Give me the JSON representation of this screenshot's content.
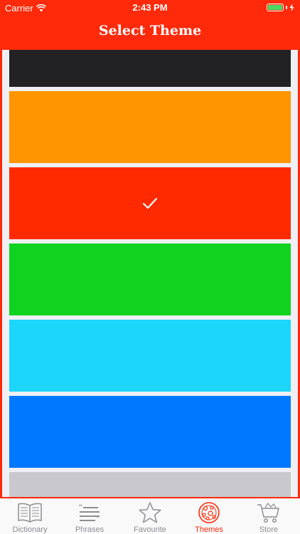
{
  "status_bar": {
    "carrier": "Carrier",
    "time": "2:43 PM"
  },
  "nav": {
    "title": "Select Theme"
  },
  "themes": [
    {
      "color": "#222225",
      "selected": false
    },
    {
      "color": "#ff9500",
      "selected": false
    },
    {
      "color": "#ff2a00",
      "selected": true
    },
    {
      "color": "#0fd31e",
      "selected": false
    },
    {
      "color": "#1cd6fc",
      "selected": false
    },
    {
      "color": "#0079ff",
      "selected": false
    },
    {
      "color": "#c8c8cd",
      "selected": false
    }
  ],
  "tabs": [
    {
      "label": "Dictionary",
      "icon": "book-icon"
    },
    {
      "label": "Phrases",
      "icon": "quote-icon"
    },
    {
      "label": "Favourite",
      "icon": "star-icon"
    },
    {
      "label": "Themes",
      "icon": "palette-icon",
      "active": true
    },
    {
      "label": "Store",
      "icon": "cart-icon"
    }
  ],
  "colors": {
    "accent": "#ff2a0a",
    "inactive": "#8e8e93"
  }
}
